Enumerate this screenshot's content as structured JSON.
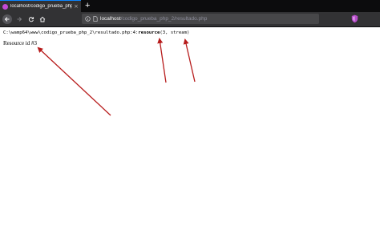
{
  "browser": {
    "tab_title": "localhost/codigo_prueba_php_2/re",
    "tab_close": "×",
    "new_tab": "+",
    "url_host": "localhost",
    "url_path": "/codigo_prueba_php_2/resultado.php"
  },
  "page": {
    "error": {
      "path": "C:\\wamp64\\www\\codigo_prueba_php_2\\resultado.php:4:",
      "keyword": "resource",
      "detail": "(3, stream)"
    },
    "output_text": "Resource id #3"
  },
  "colors": {
    "annotation_arrow": "#b71c1c",
    "tab_accent": "#0a84ff"
  },
  "icons": [
    "back-icon",
    "forward-icon",
    "reload-icon",
    "home-icon",
    "info-icon",
    "page-icon",
    "shield-icon"
  ]
}
